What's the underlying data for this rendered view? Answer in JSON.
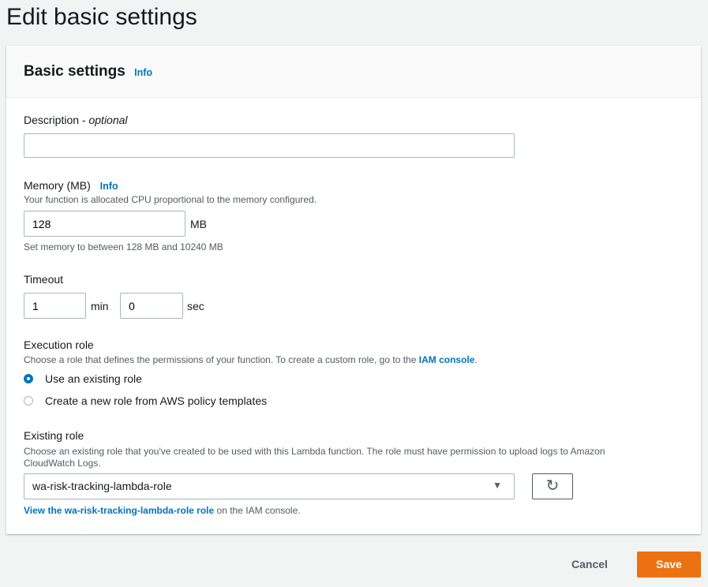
{
  "page": {
    "title": "Edit basic settings"
  },
  "section": {
    "title": "Basic settings",
    "info": "Info"
  },
  "description": {
    "label": "Description",
    "optional": "optional",
    "value": ""
  },
  "memory": {
    "label": "Memory (MB)",
    "info": "Info",
    "help": "Your function is allocated CPU proportional to the memory configured.",
    "value": "128",
    "unit": "MB",
    "constraint": "Set memory to between 128 MB and 10240 MB"
  },
  "timeout": {
    "label": "Timeout",
    "min_value": "1",
    "min_unit": "min",
    "sec_value": "0",
    "sec_unit": "sec"
  },
  "execution_role": {
    "label": "Execution role",
    "help": "Choose a role that defines the permissions of your function. To create a custom role, go to the",
    "help_link": "IAM console",
    "help_end": ".",
    "options": [
      {
        "label": "Use an existing role",
        "selected": true
      },
      {
        "label": "Create a new role from AWS policy templates",
        "selected": false
      }
    ]
  },
  "existing_role": {
    "label": "Existing role",
    "help1": "Choose an existing role that you've created to be used with this Lambda function. The role must have permission to upload logs to Amazon",
    "help2": "CloudWatch Logs.",
    "value": "wa-risk-tracking-lambda-role",
    "view_link": "View the wa-risk-tracking-lambda-role role",
    "view_suffix": "on the IAM console."
  },
  "footer": {
    "cancel": "Cancel",
    "save": "Save"
  },
  "colors": {
    "accent": "#0073bb",
    "save": "#ec7211"
  }
}
